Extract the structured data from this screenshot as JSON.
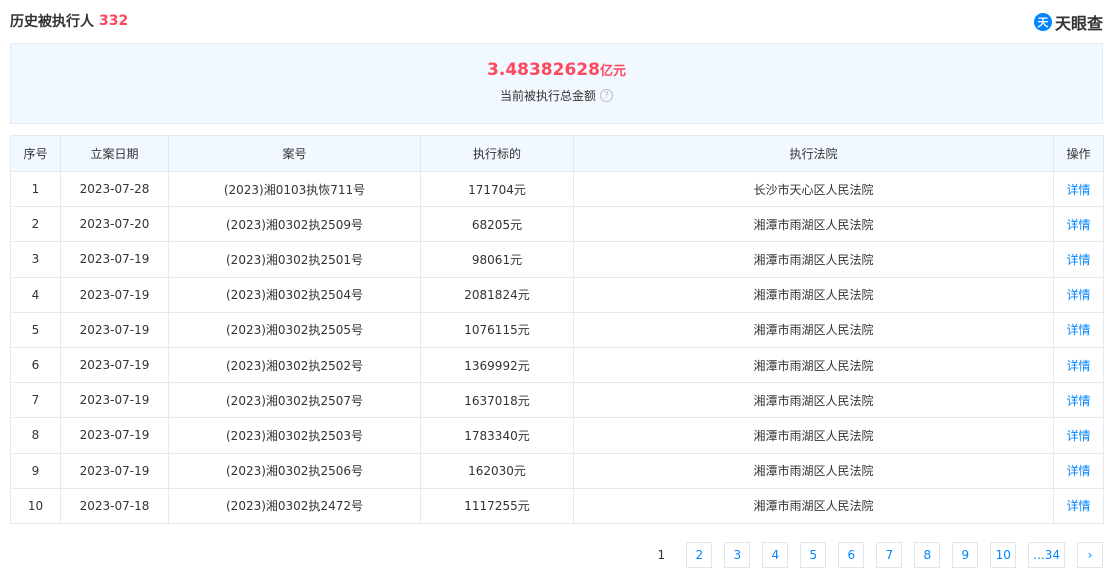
{
  "header": {
    "title": "历史被执行人",
    "count": "332",
    "brand_logo": "天",
    "brand": "天眼查"
  },
  "summary": {
    "amount": "3.48382628",
    "unit": "亿元",
    "label": "当前被执行总金额",
    "help_glyph": "?"
  },
  "table": {
    "columns": [
      "序号",
      "立案日期",
      "案号",
      "执行标的",
      "执行法院",
      "操作"
    ],
    "rows": [
      [
        "1",
        "2023-07-28",
        "(2023)湘0103执恢711号",
        "171704元",
        "长沙市天心区人民法院",
        "详情"
      ],
      [
        "2",
        "2023-07-20",
        "(2023)湘0302执2509号",
        "68205元",
        "湘潭市雨湖区人民法院",
        "详情"
      ],
      [
        "3",
        "2023-07-19",
        "(2023)湘0302执2501号",
        "98061元",
        "湘潭市雨湖区人民法院",
        "详情"
      ],
      [
        "4",
        "2023-07-19",
        "(2023)湘0302执2504号",
        "2081824元",
        "湘潭市雨湖区人民法院",
        "详情"
      ],
      [
        "5",
        "2023-07-19",
        "(2023)湘0302执2505号",
        "1076115元",
        "湘潭市雨湖区人民法院",
        "详情"
      ],
      [
        "6",
        "2023-07-19",
        "(2023)湘0302执2502号",
        "1369992元",
        "湘潭市雨湖区人民法院",
        "详情"
      ],
      [
        "7",
        "2023-07-19",
        "(2023)湘0302执2507号",
        "1637018元",
        "湘潭市雨湖区人民法院",
        "详情"
      ],
      [
        "8",
        "2023-07-19",
        "(2023)湘0302执2503号",
        "1783340元",
        "湘潭市雨湖区人民法院",
        "详情"
      ],
      [
        "9",
        "2023-07-19",
        "(2023)湘0302执2506号",
        "162030元",
        "湘潭市雨湖区人民法院",
        "详情"
      ],
      [
        "10",
        "2023-07-18",
        "(2023)湘0302执2472号",
        "1117255元",
        "湘潭市雨湖区人民法院",
        "详情"
      ]
    ]
  },
  "pagination": {
    "current": "1",
    "pages": [
      "2",
      "3",
      "4",
      "5",
      "6",
      "7",
      "8",
      "9",
      "10",
      "...34"
    ],
    "next": "›"
  }
}
